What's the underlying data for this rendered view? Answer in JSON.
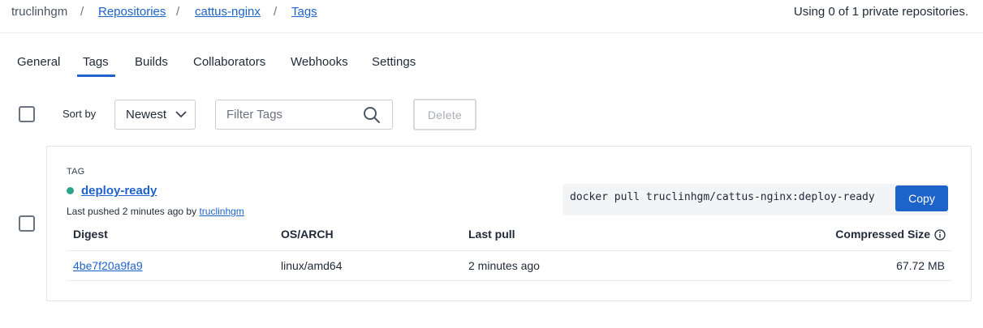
{
  "breadcrumb": {
    "owner": "truclinhgm",
    "separator": "/",
    "repositories": "Repositories",
    "repo": "cattus-nginx",
    "current": "Tags"
  },
  "usage": "Using 0 of 1 private repositories.",
  "tabs": [
    {
      "label": "General"
    },
    {
      "label": "Tags",
      "active": true
    },
    {
      "label": "Builds"
    },
    {
      "label": "Collaborators"
    },
    {
      "label": "Webhooks"
    },
    {
      "label": "Settings"
    }
  ],
  "toolbar": {
    "sort_label": "Sort by",
    "sort_value": "Newest",
    "filter_placeholder": "Filter Tags",
    "delete_label": "Delete"
  },
  "tag_card": {
    "caption": "TAG",
    "name": "deploy-ready",
    "status_color": "#2da58a",
    "pushed_text": "Last pushed 2 minutes ago by ",
    "pushed_user": "truclinhgm",
    "pull_command": "docker pull truclinhgm/cattus-nginx:deploy-ready",
    "copy_label": "Copy",
    "table": {
      "headers": [
        "Digest",
        "OS/ARCH",
        "Last pull",
        "Compressed Size"
      ],
      "rows": [
        [
          "4be7f20a9fa9",
          "linux/amd64",
          "2 minutes ago",
          "67.72 MB"
        ]
      ]
    }
  },
  "colors": {
    "accent": "#1d63c9",
    "status_dot": "#2da58a"
  }
}
